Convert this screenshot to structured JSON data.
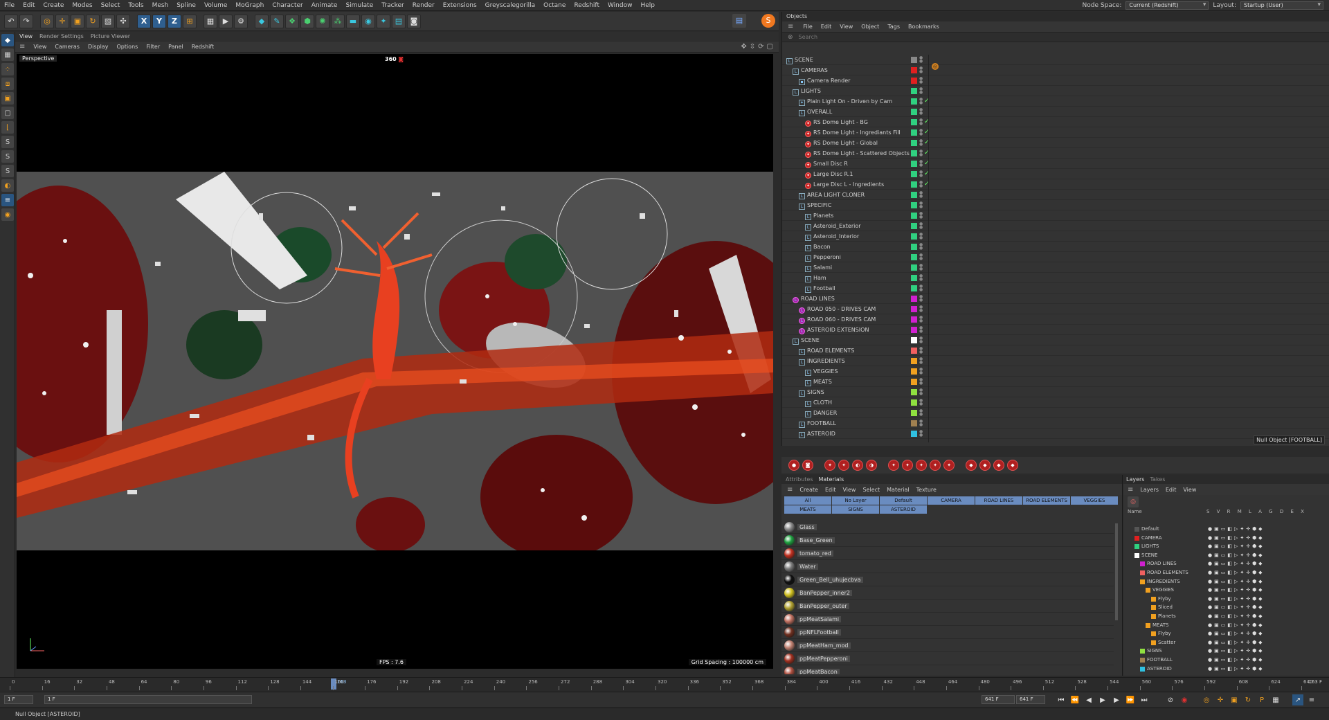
{
  "menubar": {
    "items": [
      "File",
      "Edit",
      "Create",
      "Modes",
      "Select",
      "Tools",
      "Mesh",
      "Spline",
      "Volume",
      "MoGraph",
      "Character",
      "Animate",
      "Simulate",
      "Tracker",
      "Render",
      "Extensions",
      "Greyscalegorilla",
      "Octane",
      "Redshift",
      "Window",
      "Help"
    ],
    "node_space_label": "Node Space:",
    "node_space_value": "Current (Redshift)",
    "layout_label": "Layout:",
    "layout_value": "Startup (User)"
  },
  "viewport": {
    "tabs": [
      "View",
      "Render Settings",
      "Picture Viewer"
    ],
    "menu": [
      "View",
      "Cameras",
      "Display",
      "Options",
      "Filter",
      "Panel",
      "Redshift"
    ],
    "label": "Perspective",
    "badge": "360",
    "fps": "FPS : 7.6",
    "grid": "Grid Spacing : 100000 cm"
  },
  "objects": {
    "title": "Objects",
    "menu": [
      "File",
      "Edit",
      "View",
      "Object",
      "Tags",
      "Bookmarks"
    ],
    "search_placeholder": "Search",
    "tooltip": "Null Object [FOOTBALL]",
    "rows": [
      {
        "name": "SCENE",
        "indent": 0,
        "icon": "null",
        "color": "#888888"
      },
      {
        "name": "CAMERAS",
        "indent": 1,
        "icon": "null",
        "color": "#e02020"
      },
      {
        "name": "Camera Render",
        "indent": 2,
        "icon": "cam",
        "color": "#e02020"
      },
      {
        "name": "LIGHTS",
        "indent": 1,
        "icon": "null",
        "color": "#30d080"
      },
      {
        "name": "Plain Light On - Driven by Cam",
        "indent": 2,
        "icon": "light",
        "color": "#30d080",
        "check": true
      },
      {
        "name": "OVERALL",
        "indent": 2,
        "icon": "null",
        "color": "#30d080"
      },
      {
        "name": "RS Dome Light - BG",
        "indent": 3,
        "icon": "rs",
        "color": "#30d080",
        "check": true
      },
      {
        "name": "RS Dome Light - Ingrediants Fill",
        "indent": 3,
        "icon": "rs",
        "color": "#30d080",
        "check": true
      },
      {
        "name": "RS Dome Light - Global",
        "indent": 3,
        "icon": "rs",
        "color": "#30d080",
        "check": true
      },
      {
        "name": "RS Dome Light - Scattered Objects",
        "indent": 3,
        "icon": "rs",
        "color": "#30d080",
        "check": true
      },
      {
        "name": "Small Disc R",
        "indent": 3,
        "icon": "rs",
        "color": "#30d080",
        "check": true
      },
      {
        "name": "Large Disc R.1",
        "indent": 3,
        "icon": "rs",
        "color": "#30d080",
        "check": true
      },
      {
        "name": "Large Disc L - Ingredients",
        "indent": 3,
        "icon": "rs",
        "color": "#30d080",
        "check": true
      },
      {
        "name": "AREA LIGHT CLONER",
        "indent": 2,
        "icon": "null",
        "color": "#30d080"
      },
      {
        "name": "SPECIFIC",
        "indent": 2,
        "icon": "null",
        "color": "#30d080"
      },
      {
        "name": "Planets",
        "indent": 3,
        "icon": "null",
        "color": "#30d080"
      },
      {
        "name": "Asteroid_Exterior",
        "indent": 3,
        "icon": "null",
        "color": "#30d080"
      },
      {
        "name": "Asteroid_Interior",
        "indent": 3,
        "icon": "null",
        "color": "#30d080"
      },
      {
        "name": "Bacon",
        "indent": 3,
        "icon": "null",
        "color": "#30d080"
      },
      {
        "name": "Pepperoni",
        "indent": 3,
        "icon": "null",
        "color": "#30d080"
      },
      {
        "name": "Salami",
        "indent": 3,
        "icon": "null",
        "color": "#30d080"
      },
      {
        "name": "Ham",
        "indent": 3,
        "icon": "null",
        "color": "#30d080"
      },
      {
        "name": "Football",
        "indent": 3,
        "icon": "null",
        "color": "#30d080"
      },
      {
        "name": "ROAD LINES",
        "indent": 1,
        "icon": "mag",
        "color": "#d020d0"
      },
      {
        "name": "ROAD 050 - DRIVES CAM",
        "indent": 2,
        "icon": "mag",
        "color": "#d020d0"
      },
      {
        "name": "ROAD 060 - DRIVES CAM",
        "indent": 2,
        "icon": "mag",
        "color": "#d020d0"
      },
      {
        "name": "ASTEROID EXTENSION",
        "indent": 2,
        "icon": "mag",
        "color": "#d020d0"
      },
      {
        "name": "SCENE",
        "indent": 1,
        "icon": "null",
        "color": "#ffffff"
      },
      {
        "name": "ROAD ELEMENTS",
        "indent": 2,
        "icon": "null",
        "color": "#f06060"
      },
      {
        "name": "INGREDIENTS",
        "indent": 2,
        "icon": "null",
        "color": "#f0a020"
      },
      {
        "name": "VEGGIES",
        "indent": 3,
        "icon": "null",
        "color": "#f0a020"
      },
      {
        "name": "MEATS",
        "indent": 3,
        "icon": "null",
        "color": "#f0a020"
      },
      {
        "name": "SIGNS",
        "indent": 2,
        "icon": "null",
        "color": "#90e040"
      },
      {
        "name": "CLOTH",
        "indent": 3,
        "icon": "null",
        "color": "#90e040"
      },
      {
        "name": "DANGER",
        "indent": 3,
        "icon": "null",
        "color": "#90e040"
      },
      {
        "name": "FOOTBALL",
        "indent": 2,
        "icon": "null",
        "color": "#a08050"
      },
      {
        "name": "ASTEROID",
        "indent": 2,
        "icon": "null",
        "color": "#30c0e0"
      }
    ]
  },
  "materials": {
    "tabs": [
      "Attributes",
      "Materials"
    ],
    "menu": [
      "Create",
      "Edit",
      "View",
      "Select",
      "Material",
      "Texture"
    ],
    "filters": [
      "All",
      "No Layer",
      "Default",
      "CAMERA",
      "ROAD LINES",
      "ROAD ELEMENTS",
      "VEGGIES",
      "MEATS",
      "SIGNS",
      "ASTEROID"
    ],
    "items": [
      {
        "name": "Glass",
        "color": "#888888"
      },
      {
        "name": "Base_Green",
        "color": "#20a040"
      },
      {
        "name": "tomato_red",
        "color": "#c03020"
      },
      {
        "name": "Water",
        "color": "#7a7a7a"
      },
      {
        "name": "Green_Bell_uhujecbva",
        "color": "#101010"
      },
      {
        "name": "BanPepper_inner2",
        "color": "#d0c020"
      },
      {
        "name": "BanPepper_outer",
        "color": "#b0a030"
      },
      {
        "name": "ppMeatSalami",
        "color": "#c07060"
      },
      {
        "name": "ppNFLFootball",
        "color": "#703020"
      },
      {
        "name": "ppMeatHam_mod",
        "color": "#c08070"
      },
      {
        "name": "ppMeatPepperoni",
        "color": "#a03020"
      },
      {
        "name": "ppMeatBacon",
        "color": "#b05040"
      }
    ]
  },
  "layers": {
    "tabs": [
      "Layers",
      "Takes"
    ],
    "menu": [
      "Layers",
      "Edit",
      "View"
    ],
    "header_name": "Name",
    "header_cols": "S V R M L A G D E X",
    "rows": [
      {
        "name": "Default",
        "indent": 0,
        "color": "#555555"
      },
      {
        "name": "CAMERA",
        "indent": 0,
        "color": "#e02020"
      },
      {
        "name": "LIGHTS",
        "indent": 0,
        "color": "#30d080"
      },
      {
        "name": "SCENE",
        "indent": 0,
        "color": "#ffffff"
      },
      {
        "name": "ROAD LINES",
        "indent": 1,
        "color": "#d020d0"
      },
      {
        "name": "ROAD ELEMENTS",
        "indent": 1,
        "color": "#f06060"
      },
      {
        "name": "INGREDIENTS",
        "indent": 1,
        "color": "#f0a020"
      },
      {
        "name": "VEGGIES",
        "indent": 2,
        "color": "#f0a020"
      },
      {
        "name": "Flyby",
        "indent": 3,
        "color": "#f0a020"
      },
      {
        "name": "Sliced",
        "indent": 3,
        "color": "#f0a020"
      },
      {
        "name": "Planets",
        "indent": 3,
        "color": "#f0a020"
      },
      {
        "name": "MEATS",
        "indent": 2,
        "color": "#f0a020"
      },
      {
        "name": "Flyby",
        "indent": 3,
        "color": "#f0a020"
      },
      {
        "name": "Scatter",
        "indent": 3,
        "color": "#f0a020"
      },
      {
        "name": "SIGNS",
        "indent": 1,
        "color": "#90e040"
      },
      {
        "name": "FOOTBALL",
        "indent": 1,
        "color": "#a08050"
      },
      {
        "name": "ASTEROID",
        "indent": 1,
        "color": "#30c0e0"
      }
    ]
  },
  "timeline": {
    "ticks": [
      "0",
      "16",
      "32",
      "48",
      "64",
      "80",
      "96",
      "112",
      "128",
      "144",
      "160",
      "176",
      "192",
      "208",
      "224",
      "240",
      "256",
      "272",
      "288",
      "304",
      "320",
      "336",
      "352",
      "368",
      "384",
      "400",
      "416",
      "432",
      "448",
      "464",
      "480",
      "496",
      "512",
      "528",
      "544",
      "560",
      "576",
      "592",
      "608",
      "624",
      "640"
    ],
    "current": "163",
    "end": "163 F"
  },
  "transport": {
    "start": "1 F",
    "current": "1 F",
    "min": "641 F",
    "max": "641 F"
  },
  "status": "Null Object [ASTEROID]"
}
